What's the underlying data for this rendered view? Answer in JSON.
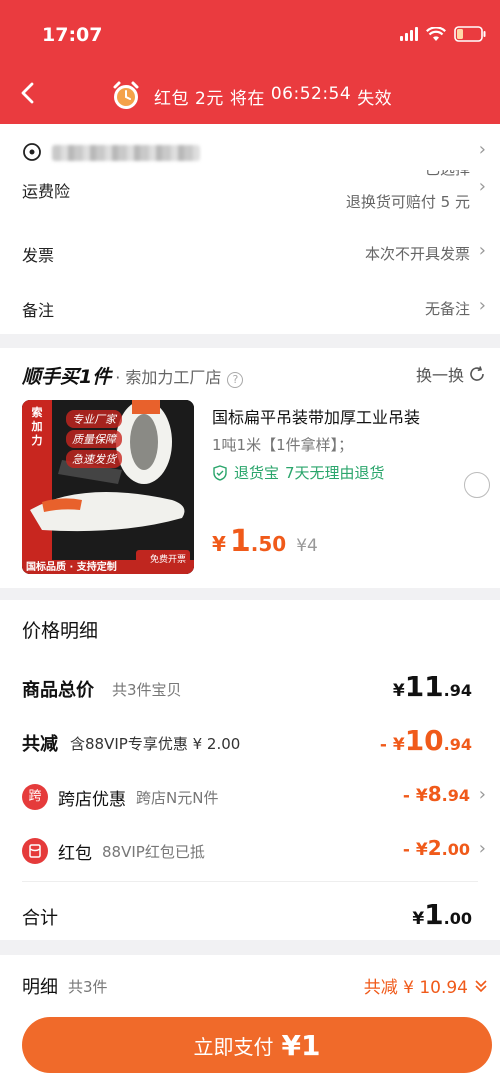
{
  "status": {
    "time": "17:07"
  },
  "header": {
    "hongbao_label": "红包",
    "hongbao_amount": "2元",
    "expire_prefix": "将在",
    "countdown": "06:52:54",
    "expire_suffix": "失效"
  },
  "order_options": {
    "freight_insurance_label": "运费险",
    "freight_insurance_value": "已选择",
    "freight_insurance_note": "退换货可赔付 5 元",
    "invoice_label": "发票",
    "invoice_value": "本次不开具发票",
    "remark_label": "备注",
    "remark_value": "无备注"
  },
  "shunshou": {
    "title": "顺手买1件",
    "store": "· 索加力工厂店",
    "swap_label": "换一换"
  },
  "product": {
    "image_tags": [
      "专业厂家",
      "质量保障",
      "急速发货"
    ],
    "brand_vertical": "索加力",
    "image_footer": "国标品质 · 支持定制",
    "image_badge": "免费开票",
    "name": "国标扁平吊装带加厚工业吊装",
    "spec": "1吨1米【1件拿样】；",
    "return_badge": "退货宝",
    "return_text": "7天无理由退货",
    "price_yen": "¥",
    "price_int": "1",
    "price_dec": ".50",
    "original_price": "¥4"
  },
  "price_detail": {
    "title": "价格明细",
    "total_label": "商品总价",
    "total_sub": "共3件宝贝",
    "total_yen": "¥",
    "total_int": "11",
    "total_dec": ".94",
    "reduce_label": "共减",
    "reduce_sub": "含88VIP专享优惠 ¥ 2.00",
    "reduce_prefix": "- ¥",
    "reduce_int": "10",
    "reduce_dec": ".94",
    "cross_badge": "跨",
    "cross_label": "跨店优惠",
    "cross_sub": "跨店N元N件",
    "cross_prefix": "- ¥",
    "cross_int": "8",
    "cross_dec": ".94",
    "hb_label": "红包",
    "hb_sub": "88VIP红包已抵",
    "hb_prefix": "- ¥",
    "hb_int": "2",
    "hb_dec": ".00",
    "sum_label": "合计",
    "sum_yen": "¥",
    "sum_int": "1",
    "sum_dec": ".00"
  },
  "bottom": {
    "detail_label": "明细",
    "detail_count": "共3件",
    "reduce_text": "共减 ¥ 10.94",
    "pay_label": "立即支付",
    "pay_amount": "¥1"
  },
  "colors": {
    "header_red": "#ea3b3f",
    "accent_orange": "#f05a1a",
    "pay_button": "#f06a2a",
    "return_green": "#2aa56b"
  }
}
